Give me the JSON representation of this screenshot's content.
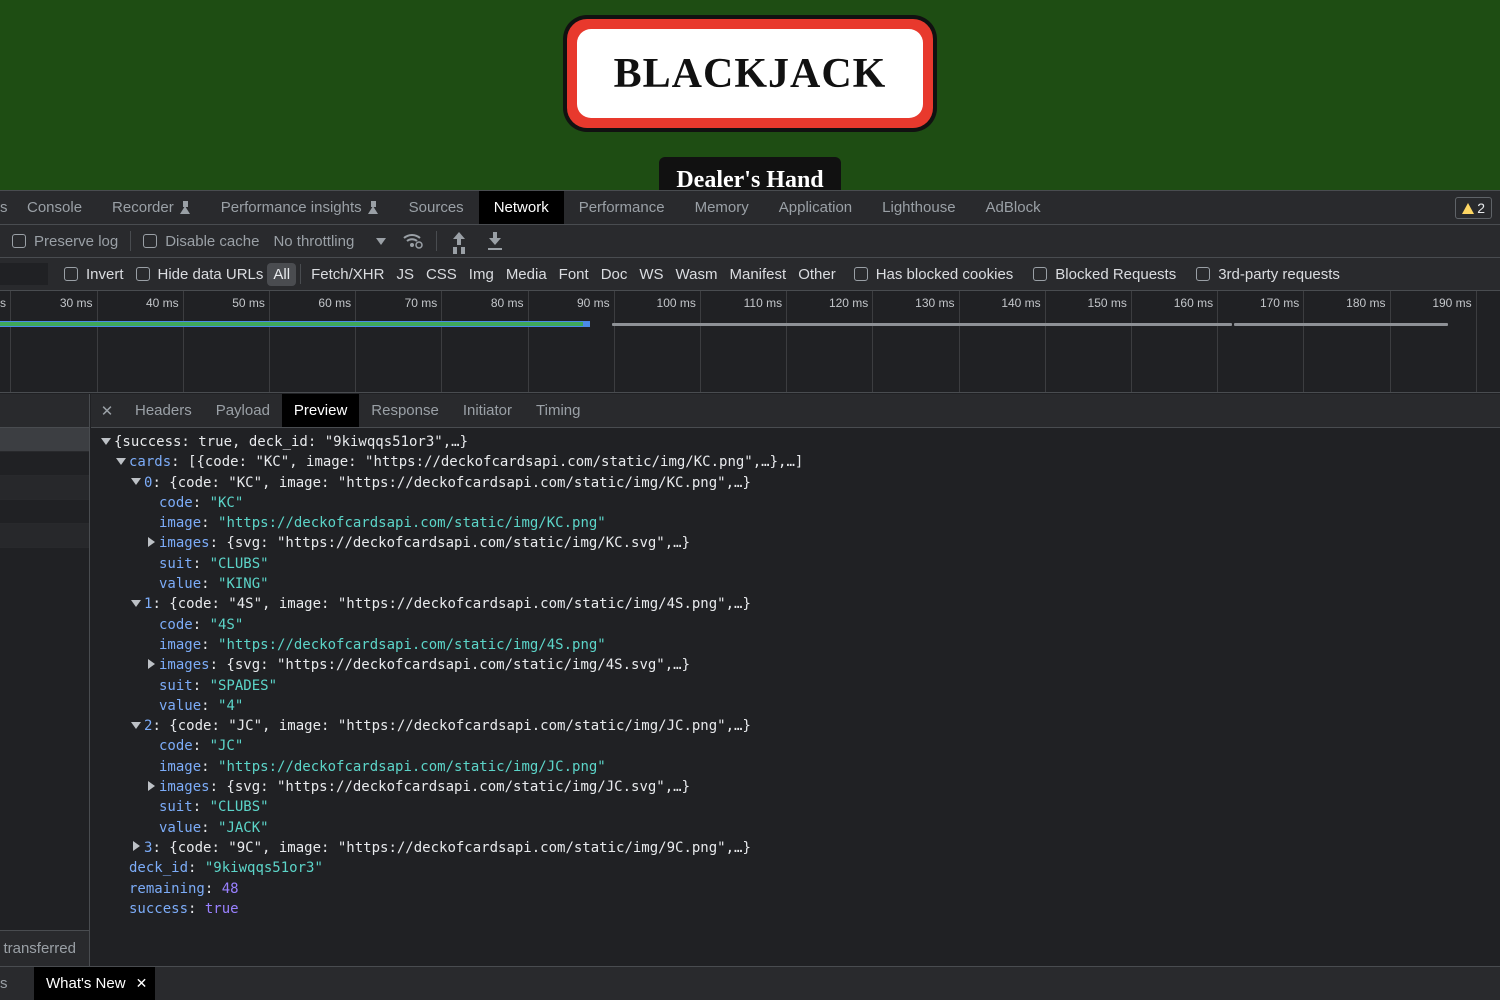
{
  "page": {
    "title": "BLACKJACK",
    "dealer_label": "Dealer's Hand"
  },
  "devtools": {
    "main_tabs": [
      {
        "label": "Console",
        "experimental": false
      },
      {
        "label": "Recorder",
        "experimental": true
      },
      {
        "label": "Performance insights",
        "experimental": true
      },
      {
        "label": "Sources",
        "experimental": false
      },
      {
        "label": "Network",
        "experimental": false,
        "active": true
      },
      {
        "label": "Performance",
        "experimental": false
      },
      {
        "label": "Memory",
        "experimental": false
      },
      {
        "label": "Application",
        "experimental": false
      },
      {
        "label": "Lighthouse",
        "experimental": false
      },
      {
        "label": "AdBlock",
        "experimental": false
      }
    ],
    "warning_count": "2",
    "toolbar": {
      "preserve_log": "Preserve log",
      "disable_cache": "Disable cache",
      "throttling": "No throttling"
    },
    "filters": {
      "invert": "Invert",
      "hide_data_urls": "Hide data URLs",
      "types": [
        "All",
        "Fetch/XHR",
        "JS",
        "CSS",
        "Img",
        "Media",
        "Font",
        "Doc",
        "WS",
        "Wasm",
        "Manifest",
        "Other"
      ],
      "active_type": "All",
      "has_blocked_cookies": "Has blocked cookies",
      "blocked_requests": "Blocked Requests",
      "third_party": "3rd-party requests"
    },
    "timeline": {
      "ticks": [
        "30 ms",
        "40 ms",
        "50 ms",
        "60 ms",
        "70 ms",
        "80 ms",
        "90 ms",
        "100 ms",
        "110 ms",
        "120 ms",
        "130 ms",
        "140 ms",
        "150 ms",
        "160 ms",
        "170 ms",
        "180 ms",
        "190 ms"
      ]
    },
    "requests_footer": "transferred",
    "detail_tabs": [
      "Headers",
      "Payload",
      "Preview",
      "Response",
      "Initiator",
      "Timing"
    ],
    "active_detail_tab": "Preview",
    "preview": [
      {
        "indent": 0,
        "arrow": "down",
        "parts": [
          [
            "plain",
            "{success: true, deck_id: \"9kiwqqs51or3\",…}"
          ]
        ]
      },
      {
        "indent": 1,
        "arrow": "down",
        "parts": [
          [
            "key",
            "cards"
          ],
          [
            "plain",
            ": [{code: \"KC\", image: \"https://deckofcardsapi.com/static/img/KC.png\",…},…]"
          ]
        ]
      },
      {
        "indent": 2,
        "arrow": "down",
        "parts": [
          [
            "key",
            "0"
          ],
          [
            "plain",
            ": {code: \"KC\", image: \"https://deckofcardsapi.com/static/img/KC.png\",…}"
          ]
        ]
      },
      {
        "indent": 3,
        "arrow": "none",
        "parts": [
          [
            "key",
            "code"
          ],
          [
            "plain",
            ": "
          ],
          [
            "str",
            "\"KC\""
          ]
        ]
      },
      {
        "indent": 3,
        "arrow": "none",
        "parts": [
          [
            "key",
            "image"
          ],
          [
            "plain",
            ": "
          ],
          [
            "str",
            "\"https://deckofcardsapi.com/static/img/KC.png\""
          ]
        ]
      },
      {
        "indent": 3,
        "arrow": "right",
        "parts": [
          [
            "key",
            "images"
          ],
          [
            "plain",
            ": {svg: \"https://deckofcardsapi.com/static/img/KC.svg\",…}"
          ]
        ]
      },
      {
        "indent": 3,
        "arrow": "none",
        "parts": [
          [
            "key",
            "suit"
          ],
          [
            "plain",
            ": "
          ],
          [
            "str",
            "\"CLUBS\""
          ]
        ]
      },
      {
        "indent": 3,
        "arrow": "none",
        "parts": [
          [
            "key",
            "value"
          ],
          [
            "plain",
            ": "
          ],
          [
            "str",
            "\"KING\""
          ]
        ]
      },
      {
        "indent": 2,
        "arrow": "down",
        "parts": [
          [
            "key",
            "1"
          ],
          [
            "plain",
            ": {code: \"4S\", image: \"https://deckofcardsapi.com/static/img/4S.png\",…}"
          ]
        ]
      },
      {
        "indent": 3,
        "arrow": "none",
        "parts": [
          [
            "key",
            "code"
          ],
          [
            "plain",
            ": "
          ],
          [
            "str",
            "\"4S\""
          ]
        ]
      },
      {
        "indent": 3,
        "arrow": "none",
        "parts": [
          [
            "key",
            "image"
          ],
          [
            "plain",
            ": "
          ],
          [
            "str",
            "\"https://deckofcardsapi.com/static/img/4S.png\""
          ]
        ]
      },
      {
        "indent": 3,
        "arrow": "right",
        "parts": [
          [
            "key",
            "images"
          ],
          [
            "plain",
            ": {svg: \"https://deckofcardsapi.com/static/img/4S.svg\",…}"
          ]
        ]
      },
      {
        "indent": 3,
        "arrow": "none",
        "parts": [
          [
            "key",
            "suit"
          ],
          [
            "plain",
            ": "
          ],
          [
            "str",
            "\"SPADES\""
          ]
        ]
      },
      {
        "indent": 3,
        "arrow": "none",
        "parts": [
          [
            "key",
            "value"
          ],
          [
            "plain",
            ": "
          ],
          [
            "str",
            "\"4\""
          ]
        ]
      },
      {
        "indent": 2,
        "arrow": "down",
        "parts": [
          [
            "key",
            "2"
          ],
          [
            "plain",
            ": {code: \"JC\", image: \"https://deckofcardsapi.com/static/img/JC.png\",…}"
          ]
        ]
      },
      {
        "indent": 3,
        "arrow": "none",
        "parts": [
          [
            "key",
            "code"
          ],
          [
            "plain",
            ": "
          ],
          [
            "str",
            "\"JC\""
          ]
        ]
      },
      {
        "indent": 3,
        "arrow": "none",
        "parts": [
          [
            "key",
            "image"
          ],
          [
            "plain",
            ": "
          ],
          [
            "str",
            "\"https://deckofcardsapi.com/static/img/JC.png\""
          ]
        ]
      },
      {
        "indent": 3,
        "arrow": "right",
        "parts": [
          [
            "key",
            "images"
          ],
          [
            "plain",
            ": {svg: \"https://deckofcardsapi.com/static/img/JC.svg\",…}"
          ]
        ]
      },
      {
        "indent": 3,
        "arrow": "none",
        "parts": [
          [
            "key",
            "suit"
          ],
          [
            "plain",
            ": "
          ],
          [
            "str",
            "\"CLUBS\""
          ]
        ]
      },
      {
        "indent": 3,
        "arrow": "none",
        "parts": [
          [
            "key",
            "value"
          ],
          [
            "plain",
            ": "
          ],
          [
            "str",
            "\"JACK\""
          ]
        ]
      },
      {
        "indent": 2,
        "arrow": "right",
        "parts": [
          [
            "key",
            "3"
          ],
          [
            "plain",
            ": {code: \"9C\", image: \"https://deckofcardsapi.com/static/img/9C.png\",…}"
          ]
        ]
      },
      {
        "indent": 1,
        "arrow": "none",
        "parts": [
          [
            "key",
            "deck_id"
          ],
          [
            "plain",
            ": "
          ],
          [
            "str",
            "\"9kiwqqs51or3\""
          ]
        ]
      },
      {
        "indent": 1,
        "arrow": "none",
        "parts": [
          [
            "key",
            "remaining"
          ],
          [
            "plain",
            ": "
          ],
          [
            "num",
            "48"
          ]
        ]
      },
      {
        "indent": 1,
        "arrow": "none",
        "parts": [
          [
            "key",
            "success"
          ],
          [
            "plain",
            ": "
          ],
          [
            "bool",
            "true"
          ]
        ]
      }
    ],
    "drawer": {
      "whats_new": "What's New"
    }
  },
  "colors": {
    "page_bg": "#1e4d13",
    "title_border": "#e8392d",
    "devtools_bg": "#202124",
    "json_key": "#7cacf8",
    "json_string": "#5cd5c9",
    "json_number": "#9980ff"
  }
}
